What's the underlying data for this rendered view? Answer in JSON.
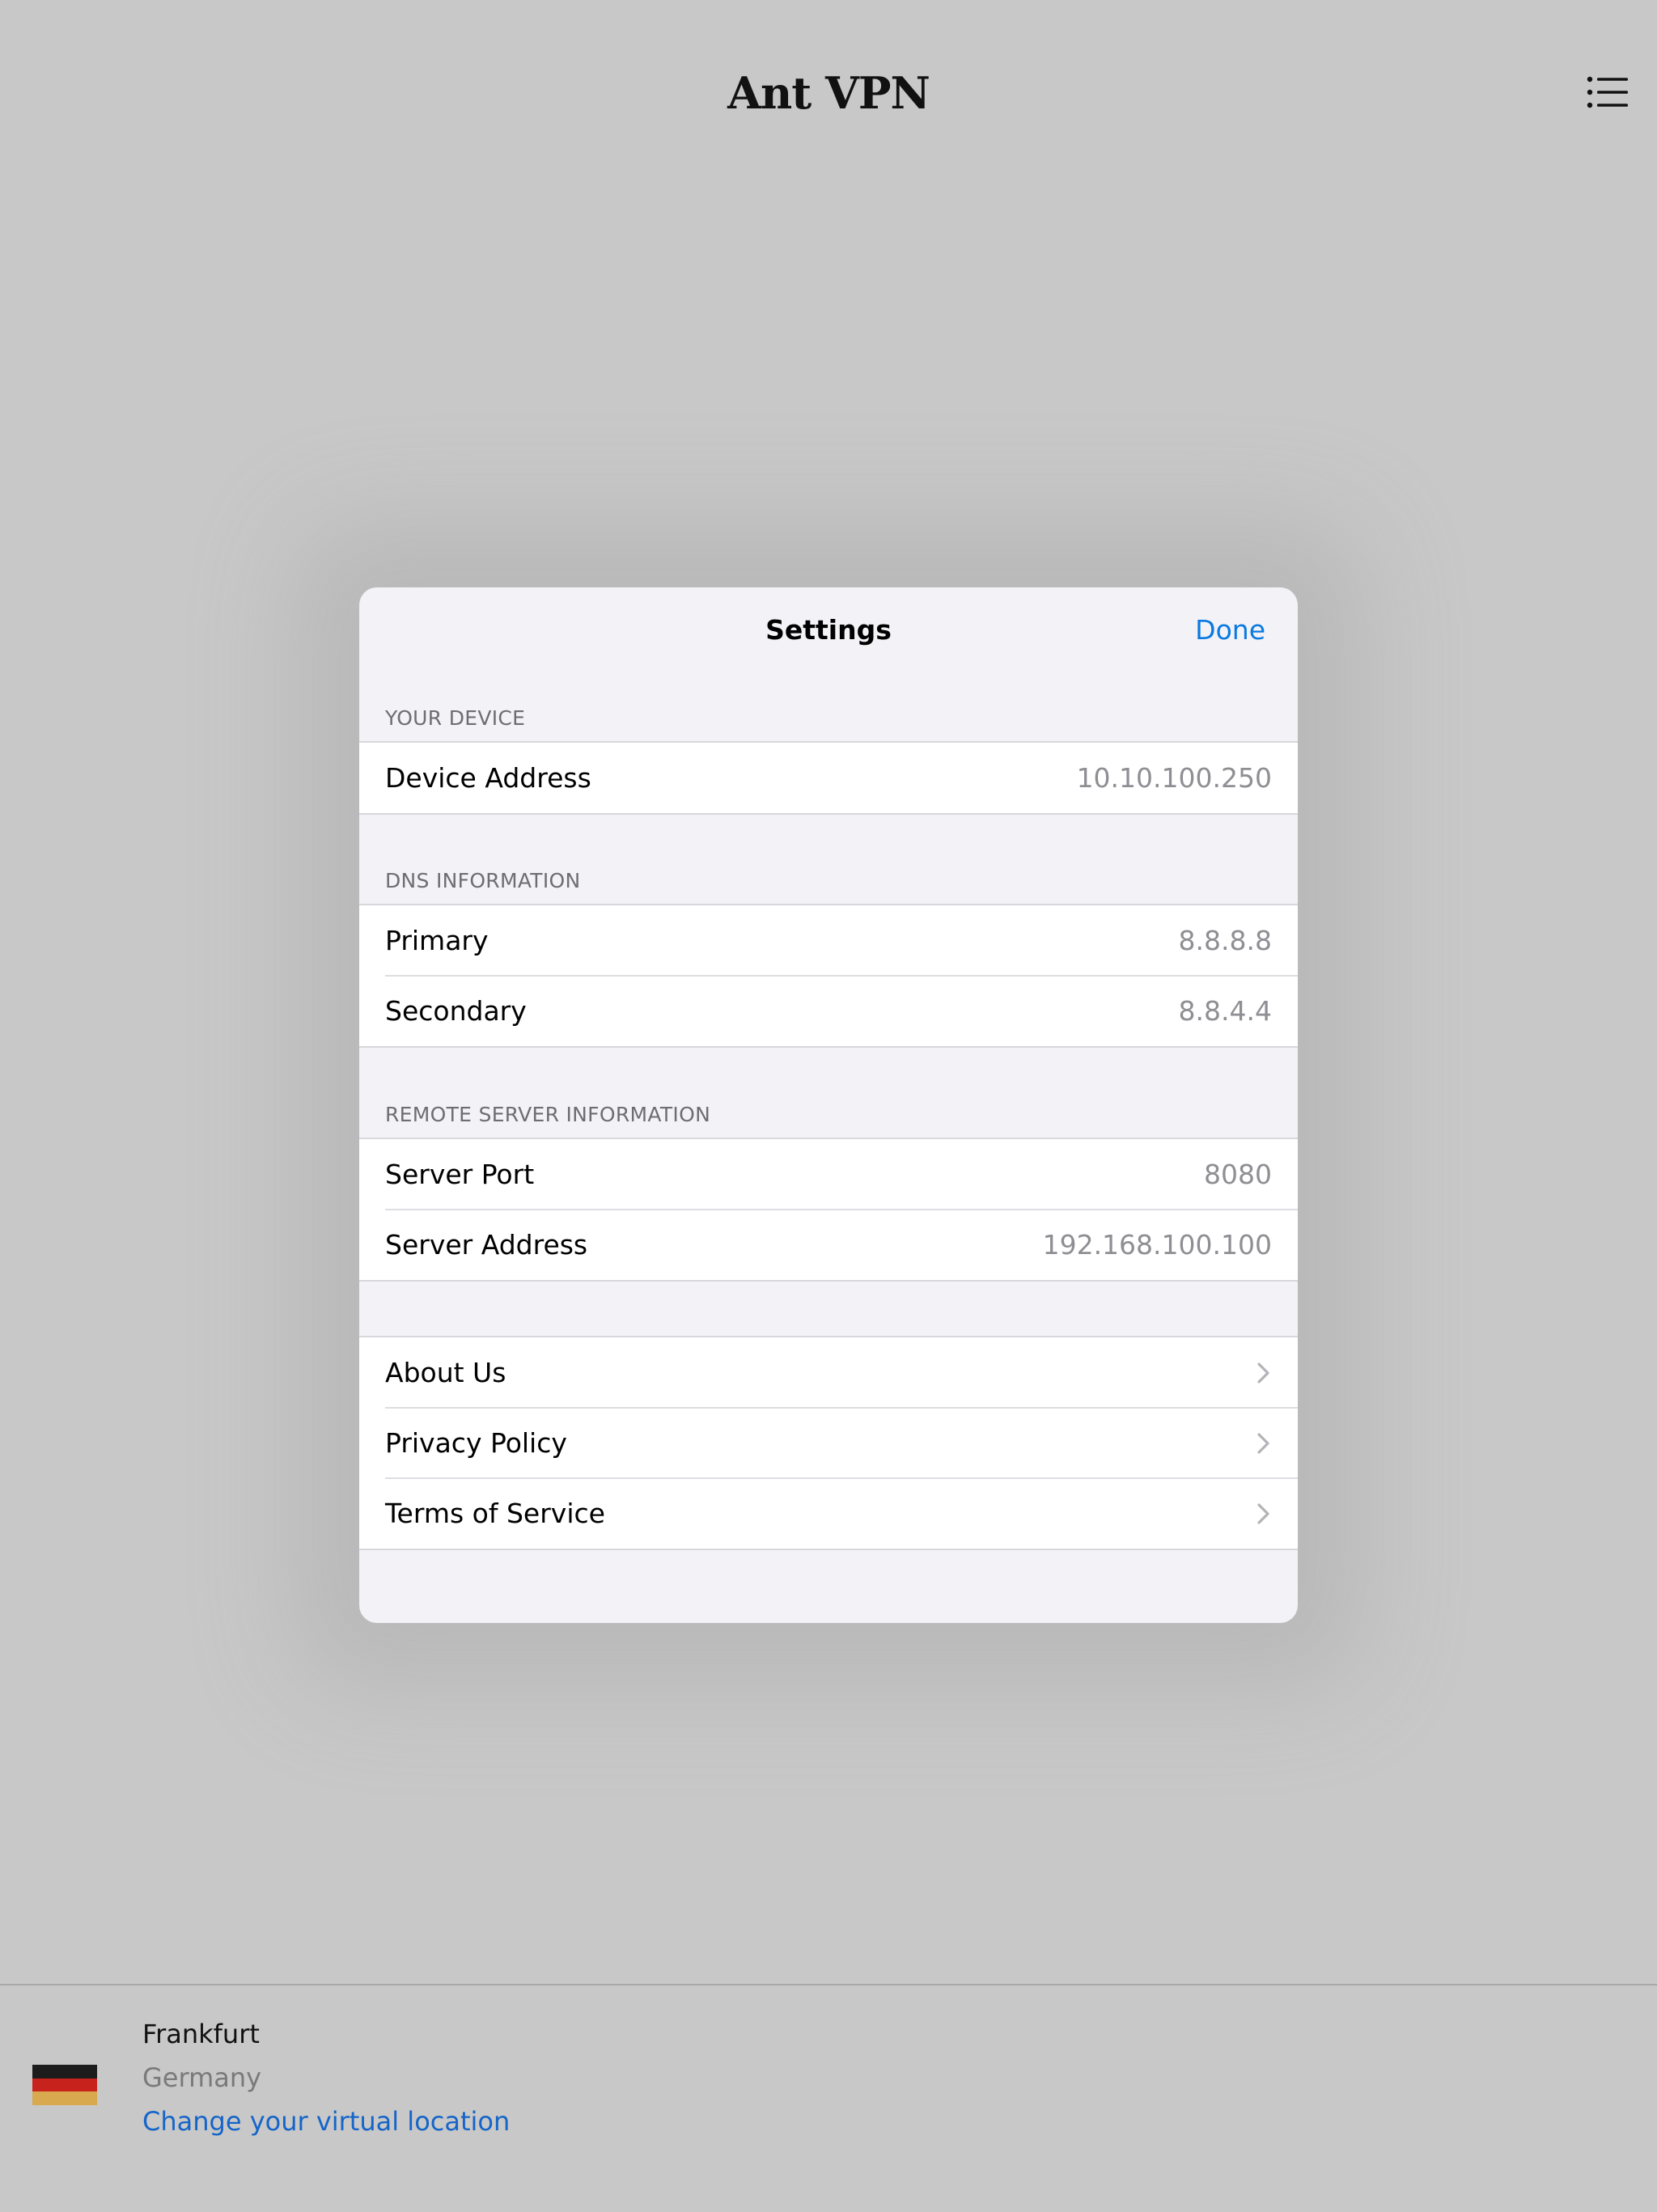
{
  "app": {
    "title": "Ant VPN",
    "menu_icon": "list-icon"
  },
  "settings": {
    "title": "Settings",
    "done_label": "Done",
    "sections": {
      "device": {
        "header": "YOUR DEVICE",
        "rows": [
          {
            "label": "Device Address",
            "value": "10.10.100.250"
          }
        ]
      },
      "dns": {
        "header": "DNS INFORMATION",
        "rows": [
          {
            "label": "Primary",
            "value": "8.8.8.8"
          },
          {
            "label": "Secondary",
            "value": "8.8.4.4"
          }
        ]
      },
      "remote": {
        "header": "REMOTE SERVER INFORMATION",
        "rows": [
          {
            "label": "Server Port",
            "value": "8080"
          },
          {
            "label": "Server Address",
            "value": "192.168.100.100"
          }
        ]
      },
      "links": {
        "rows": [
          {
            "label": "About Us",
            "icon": "chevron-right-icon"
          },
          {
            "label": "Privacy Policy",
            "icon": "chevron-right-icon"
          },
          {
            "label": "Terms of Service",
            "icon": "chevron-right-icon"
          }
        ]
      }
    }
  },
  "location": {
    "city": "Frankfurt",
    "country": "Germany",
    "change_label": "Change your virtual location",
    "flag_icon": "germany-flag-icon",
    "flag_colors": [
      "#1c1c1c",
      "#c8221d",
      "#d8a94e"
    ]
  },
  "colors": {
    "accent": "#0a7ae0",
    "link": "#1565c9",
    "background": "#c8c8c8",
    "sheet_background": "#f2f2f7"
  }
}
